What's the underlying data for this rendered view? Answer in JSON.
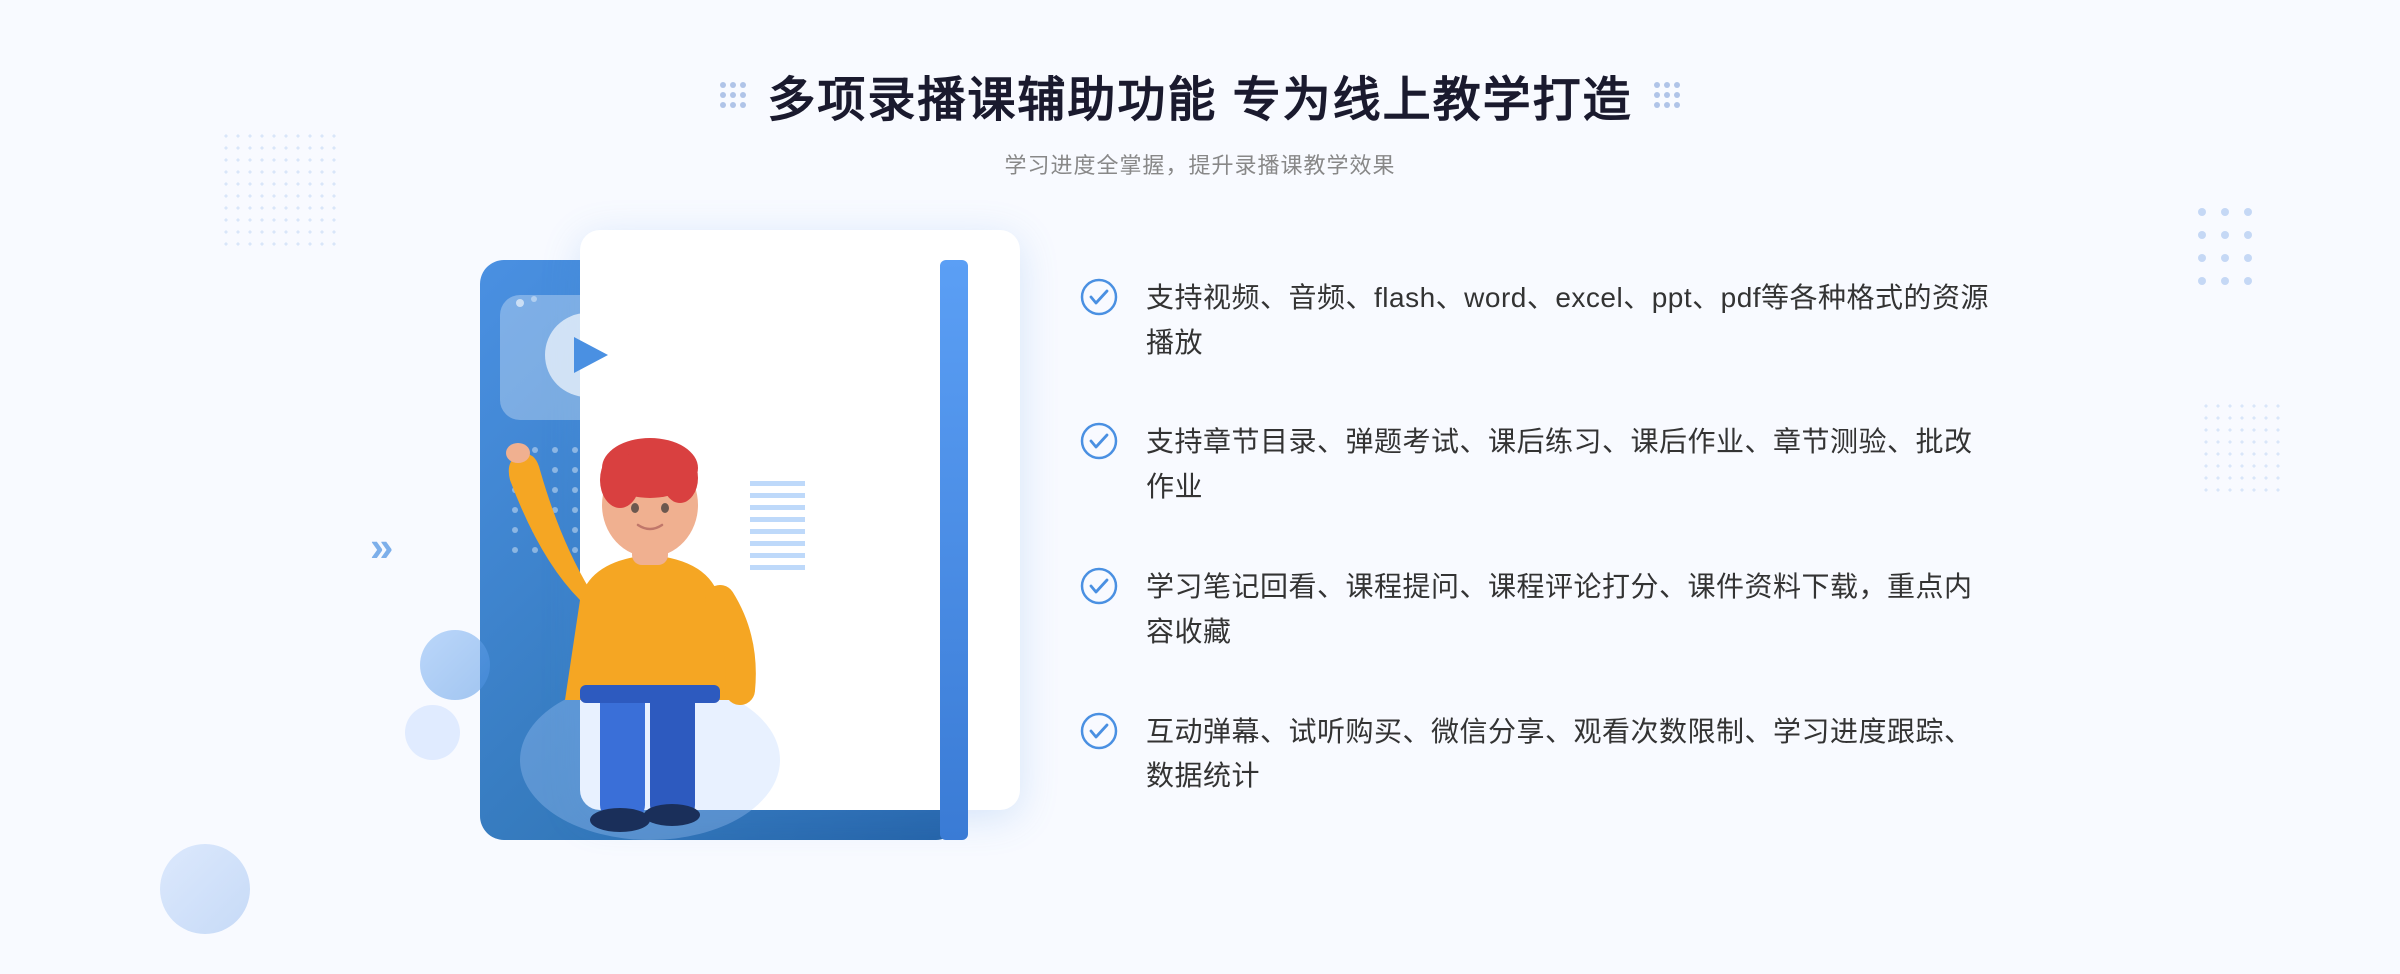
{
  "header": {
    "title": "多项录播课辅助功能 专为线上教学打造",
    "subtitle": "学习进度全掌握，提升录播课教学效果"
  },
  "features": [
    {
      "id": 1,
      "text": "支持视频、音频、flash、word、excel、ppt、pdf等各种格式的资源播放"
    },
    {
      "id": 2,
      "text": "支持章节目录、弹题考试、课后练习、课后作业、章节测验、批改作业"
    },
    {
      "id": 3,
      "text": "学习笔记回看、课程提问、课程评论打分、课件资料下载，重点内容收藏"
    },
    {
      "id": 4,
      "text": "互动弹幕、试听购买、微信分享、观看次数限制、学习进度跟踪、数据统计"
    }
  ],
  "icons": {
    "check": "check-circle-icon",
    "play": "play-icon",
    "left_arrow": "chevron-left-icon",
    "dots_decoration": "dots-decoration"
  },
  "colors": {
    "primary_blue": "#4a90e2",
    "dark_blue": "#2563a8",
    "text_dark": "#1a1a2e",
    "text_gray": "#888888",
    "text_content": "#333333",
    "check_color": "#4a90e2",
    "bg": "#f8faff"
  }
}
